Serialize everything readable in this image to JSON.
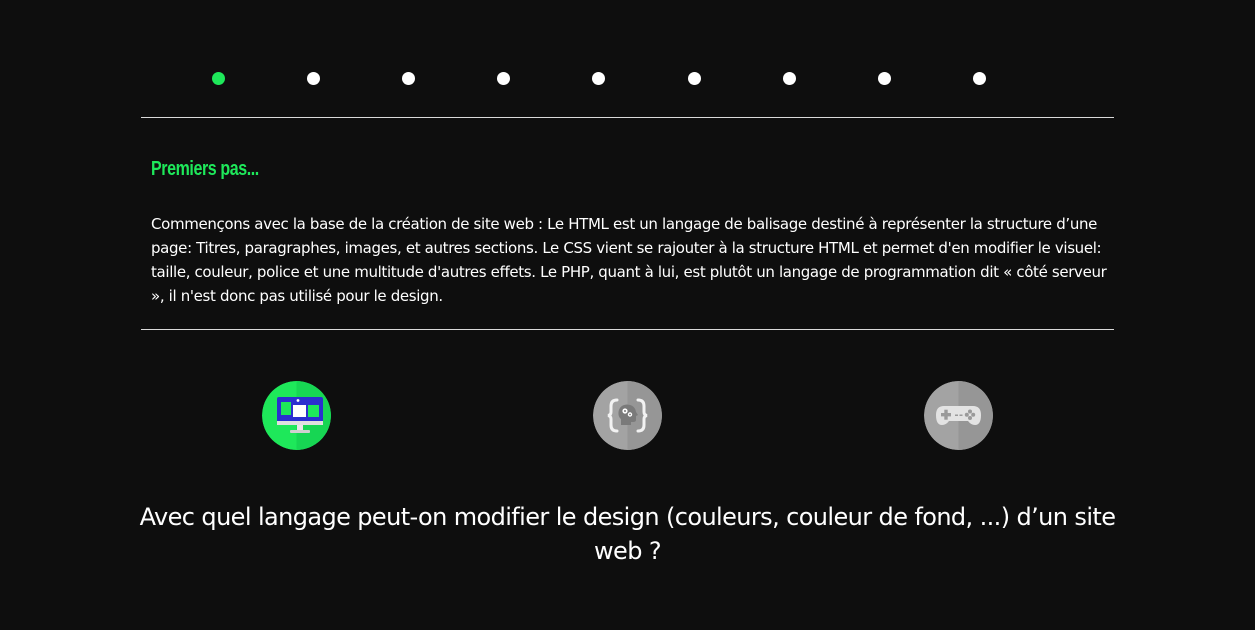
{
  "progress": {
    "total_steps": 9,
    "current_step": 1,
    "active_color": "#1ee85a",
    "inactive_color": "#ffffff"
  },
  "lesson": {
    "title": "Premiers pas...",
    "text": "Commençons avec la base de la création de site web : Le HTML est un langage de balisage destiné à représenter la structure d’une page: Titres, paragraphes, images, et autres sections. Le CSS vient se rajouter à la structure HTML et permet d'en modifier le visuel: taille, couleur, police et une multitude d'autres effets. Le PHP, quant à lui, est plutôt un langage de programmation dit « côté serveur », il n'est donc pas utilisé pour le design."
  },
  "choices": [
    {
      "icon": "monitor-design-icon",
      "selected": true,
      "color": "#1ee85a"
    },
    {
      "icon": "code-brain-icon",
      "selected": false,
      "color": "#9a9a9a"
    },
    {
      "icon": "gamepad-icon",
      "selected": false,
      "color": "#9a9a9a"
    }
  ],
  "question": {
    "text": "Avec quel langage peut-on modifier le design (couleurs, couleur de fond, ...) d’un site web ?"
  }
}
